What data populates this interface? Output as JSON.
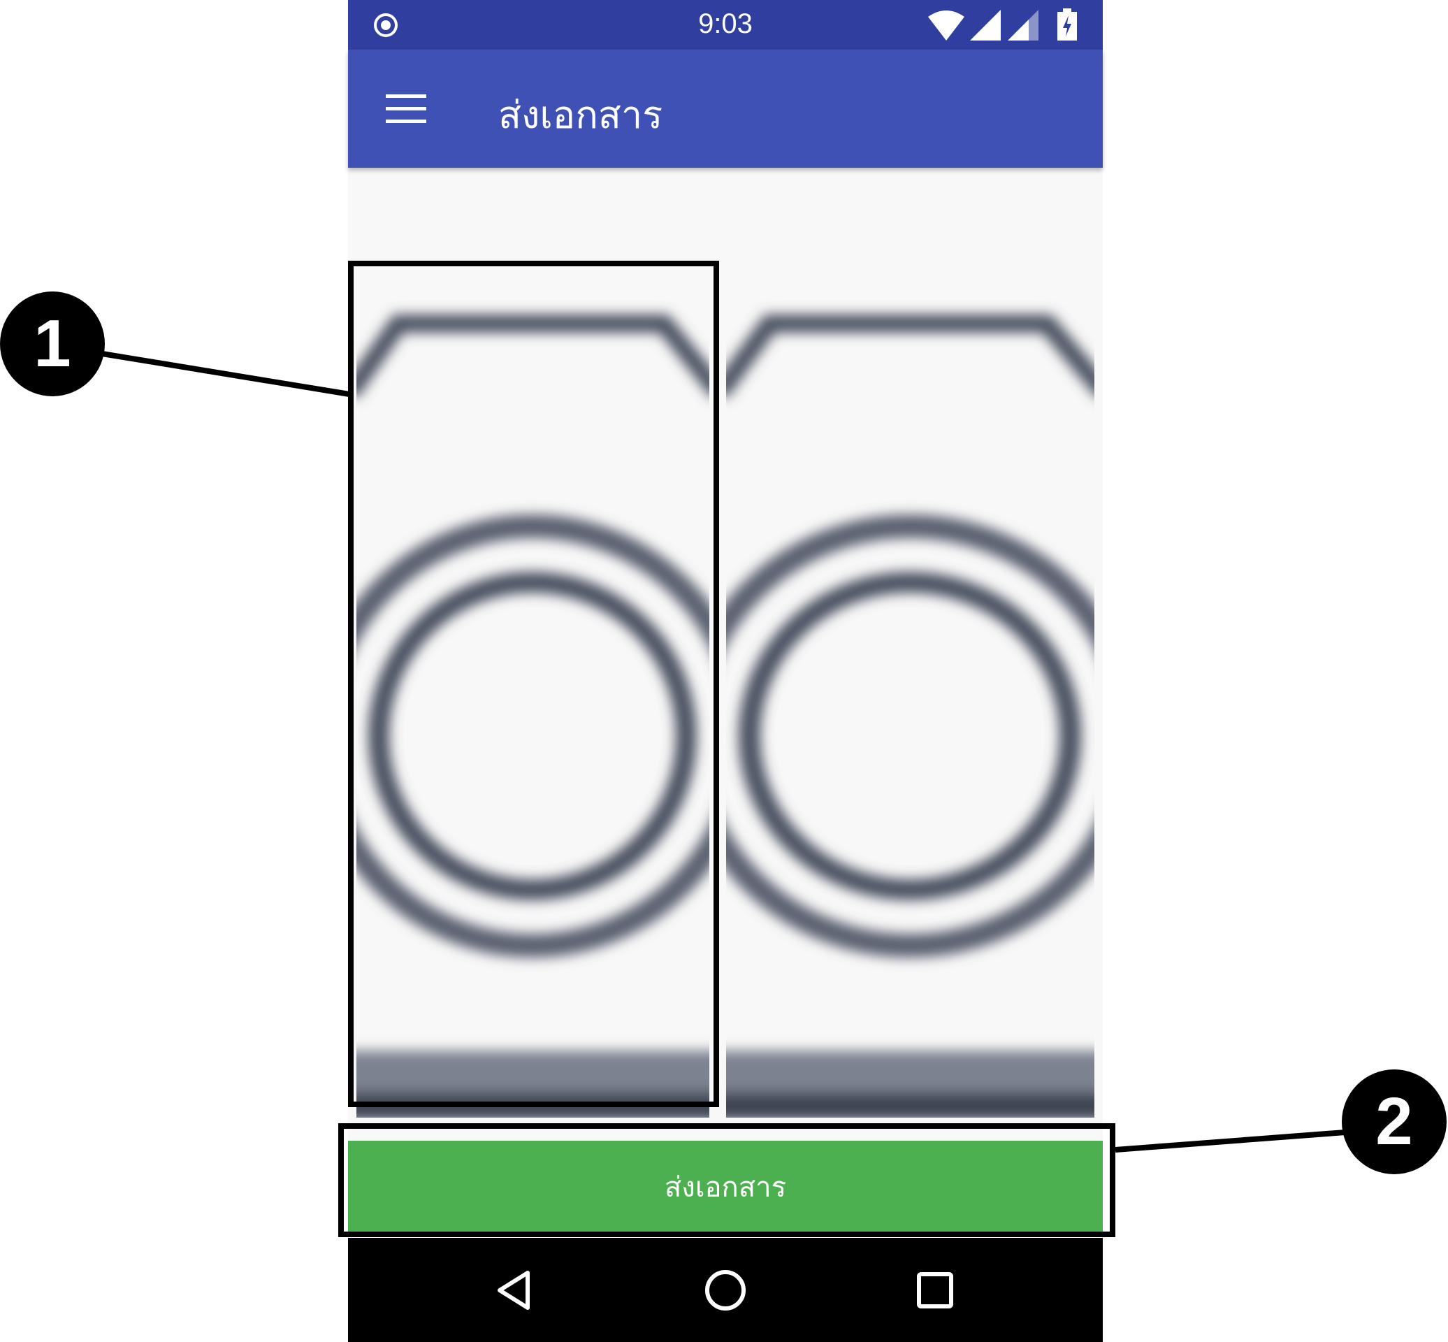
{
  "status_bar": {
    "time": "9:03",
    "icons": [
      "target-icon",
      "wifi-icon",
      "signal-icon",
      "signal-icon",
      "battery-charging-icon"
    ]
  },
  "app_bar": {
    "title": "ส่งเอกสาร",
    "menu_icon": "hamburger-menu-icon"
  },
  "content": {
    "images": [
      {
        "icon": "camera-placeholder-icon"
      },
      {
        "icon": "camera-placeholder-icon"
      }
    ]
  },
  "send_button": {
    "label": "ส่งเอกสาร",
    "color": "#4caf50"
  },
  "nav_bar": {
    "icons": [
      "back-icon",
      "home-icon",
      "recents-icon"
    ]
  },
  "annotations": [
    {
      "label": "1"
    },
    {
      "label": "2"
    }
  ],
  "colors": {
    "status_bar": "#303f9f",
    "app_bar": "#3f51b5"
  }
}
